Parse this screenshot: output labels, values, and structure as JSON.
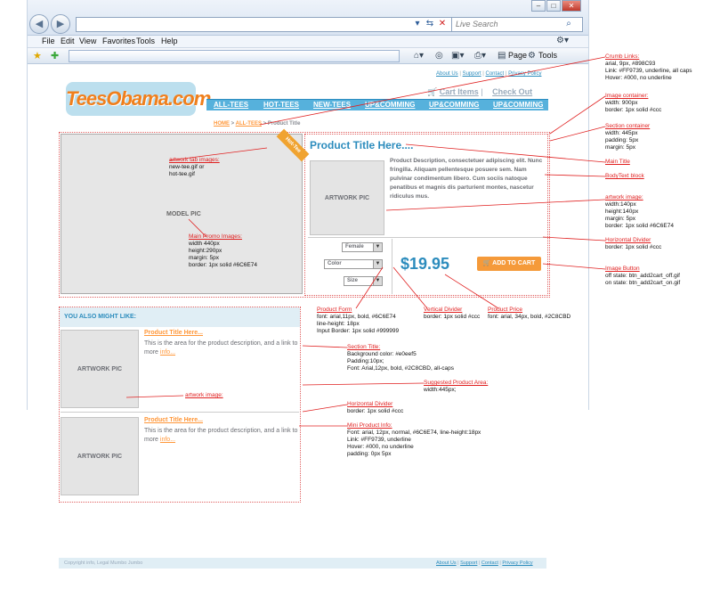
{
  "browser": {
    "search_placeholder": "Live Search",
    "menu": [
      "File",
      "Edit",
      "View",
      "Favorites",
      "Tools",
      "Help"
    ],
    "toolbar": {
      "page_label": "Page",
      "tools_label": "Tools"
    }
  },
  "site": {
    "toplinks": {
      "about": "About Us",
      "support": "Support",
      "contact": "Contact",
      "privacy": "Privacy Policy"
    },
    "logo_text": "TeesObama.com",
    "cart": {
      "items": "Cart Items",
      "checkout": "Check Out"
    },
    "nav": [
      "ALL-TEES",
      "HOT-TEES",
      "NEW-TEES",
      "UP&COMMING",
      "UP&COMMING",
      "UP&COMMING"
    ],
    "breadcrumb": {
      "home": "HOME",
      "sep": ">",
      "all": "ALL-TEES",
      "current": "Product Title"
    },
    "promo": {
      "label": "MODEL PIC",
      "ribbon": "Hot-Tee"
    },
    "product": {
      "title": "Product Title Here....",
      "art_label": "ARTWORK PIC",
      "description": "Product Description, consectetuer adipiscing elit. Nunc fringilla. Aliquam pellentesque posuere sem. Nam pulvinar condimentum libero. Cum sociis natoque penatibus et magnis dis parturient montes, nascetur ridiculus mus.",
      "form": {
        "gender": "Female",
        "color": "Color",
        "size": "Size"
      },
      "price": "$19.95",
      "add_to_cart": "ADD TO CART"
    },
    "suggest": {
      "title": "YOU ALSO MIGHT LIKE:",
      "items": [
        {
          "title": "Product Title Here...",
          "art": "ARTWORK PIC",
          "desc": "This is the area for the product description, and a link to more",
          "link": "info..."
        },
        {
          "title": "Product Title Here...",
          "art": "ARTWORK PIC",
          "desc": "This is the area for the product description, and a link to more",
          "link": "info..."
        }
      ]
    },
    "footer": {
      "left": "Copyright info, Legal Mumbo Jumbo",
      "about": "About Us",
      "support": "Support",
      "contact": "Contact",
      "privacy": "Privacy Policy"
    }
  },
  "annotations": {
    "crumb": {
      "title": "Crumb Links:",
      "lines": [
        "arial, 9px, #898C93",
        "Link: #FF9739, underline, all caps",
        "Hover: #000, no underline"
      ]
    },
    "image_container": {
      "title": "Image container:",
      "lines": [
        "width: 900px",
        "border: 1px solid #ccc"
      ]
    },
    "section_container": {
      "title": "Section container",
      "lines": [
        "width: 445px",
        "padding: 5px",
        "margin: 5px"
      ]
    },
    "main_title": {
      "title": "Main Title",
      "lines": []
    },
    "bodytext": {
      "title": "BodyText block",
      "lines": []
    },
    "artwork_image": {
      "title": "artwork image:",
      "lines": [
        "width:140px",
        "height:140px",
        "margin: 5px",
        "border: 1px solid #6C6E74"
      ]
    },
    "horizontal_divider": {
      "title": "Horizontal Divider",
      "lines": [
        "border: 1px solid #ccc"
      ]
    },
    "image_button": {
      "title": "Image Button",
      "lines": [
        "off state: btn_add2cart_off.gif",
        "on state: btn_add2cart_on.gif"
      ]
    },
    "artwork_tab": {
      "title": "artwork tab images:",
      "lines": [
        "new-tee.gif  or",
        "hot-tee.gif"
      ]
    },
    "main_promo": {
      "title": "Main Promo Images:",
      "lines": [
        "width 440px",
        "height:290px",
        "margin: 5px",
        "border: 1px solid #6C6E74"
      ]
    },
    "product_form": {
      "title": "Product Form",
      "lines": [
        "font:  arial,11px, bold, #6C6E74",
        "line-height: 18px",
        "Input Border: 1px solid #999999"
      ]
    },
    "vertical_divider": {
      "title": "Vertical Divider",
      "lines": [
        "border: 1px solid #ccc"
      ]
    },
    "product_price": {
      "title": "Product Price",
      "lines": [
        "font: arial, 34px, bold, #2C8CBD"
      ]
    },
    "section_title": {
      "title": "Section Title:",
      "lines": [
        "Background color: #e0eef5",
        "Padding:10px;",
        "Font: Arial,12px, bold, #2C8CBD, all-caps"
      ]
    },
    "artwork_image2": {
      "title": "artwork image:",
      "lines": []
    },
    "suggested_area": {
      "title": "Suggested Product Area:",
      "lines": [
        "width:445px;"
      ]
    },
    "horizontal_divider2": {
      "title": "Horizontal Divider",
      "lines": [
        "border: 1px solid #ccc"
      ]
    },
    "mini_info": {
      "title": "Mini Product Info:",
      "lines": [
        "Font: arial, 12px, normal, #6C6E74, line-height:18px",
        "Link: #FF9739, underline",
        "Hover: #000, no underline",
        "padding: 0px 5px"
      ]
    }
  }
}
